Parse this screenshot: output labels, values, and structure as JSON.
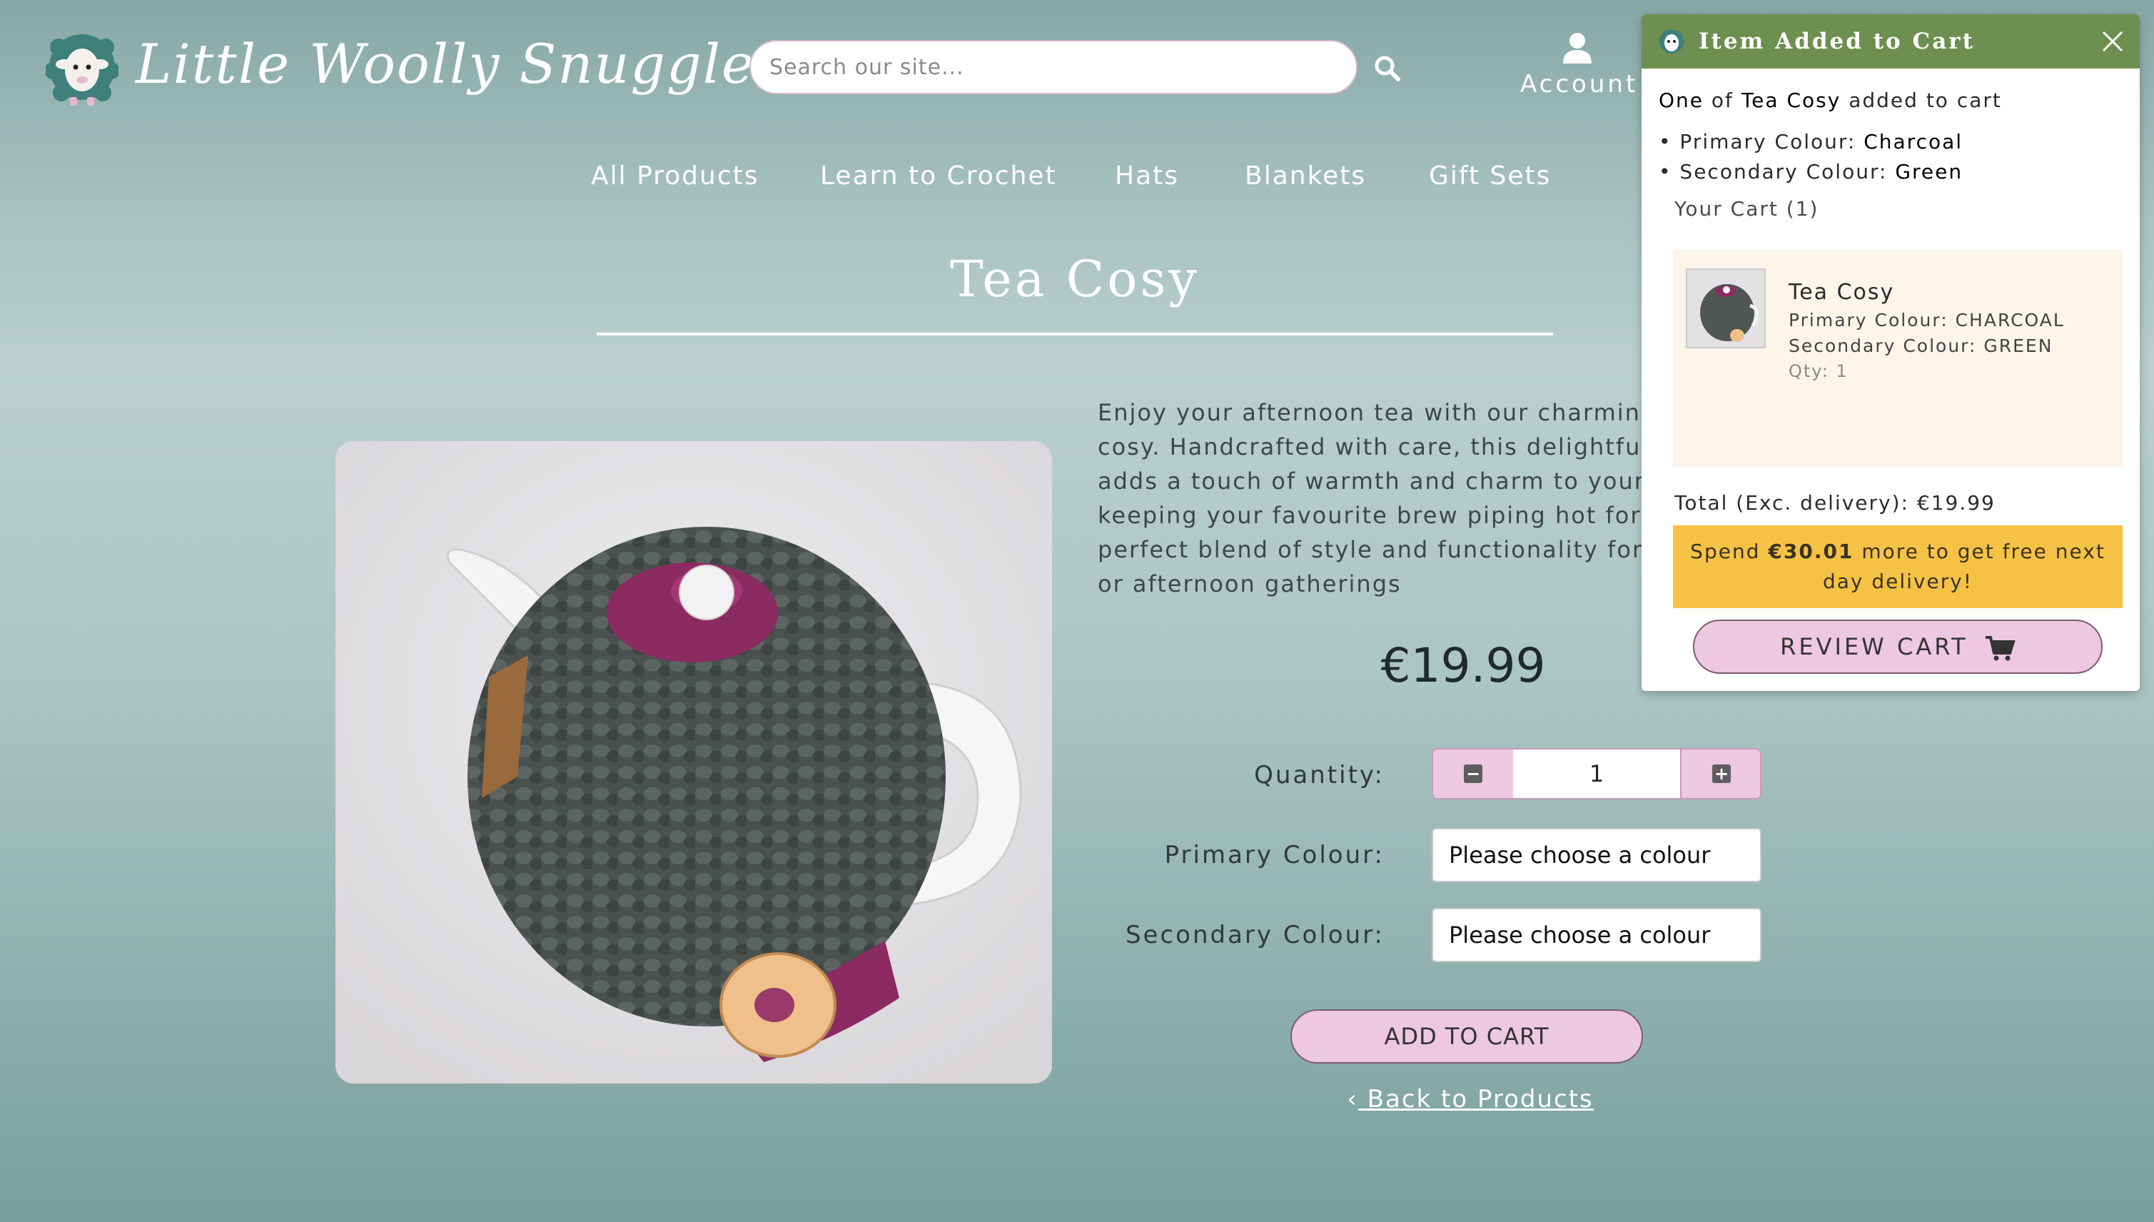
{
  "brand": {
    "name": "Little Woolly Snuggles"
  },
  "search": {
    "placeholder": "Search our site..."
  },
  "header": {
    "account_label": "Account"
  },
  "nav": {
    "items": [
      "All Products",
      "Learn to Crochet",
      "Hats",
      "Blankets",
      "Gift Sets"
    ]
  },
  "product": {
    "title": "Tea Cosy",
    "description": "Enjoy your afternoon tea with our charming crochet tea cosy. Handcrafted with care, this delightful accessory adds a touch of warmth and charm to your teapot, keeping your favourite brew piping hot for longer. A perfect blend of style and functionality for cozy mornings or afternoon gatherings",
    "price": "€19.99",
    "quantity_label": "Quantity:",
    "quantity_value": "1",
    "primary_colour_label": "Primary Colour:",
    "primary_colour_value": "Please choose a colour",
    "secondary_colour_label": "Secondary Colour:",
    "secondary_colour_value": "Please choose a colour",
    "add_to_cart_label": "ADD TO CART",
    "back_link_label": "Back to Products"
  },
  "popup": {
    "title": "Item Added to Cart",
    "added_prefix": "One",
    "added_mid": "of",
    "added_item": "Tea Cosy",
    "added_suffix": "added to cart",
    "option_1_label": "Primary Colour:",
    "option_1_value": "Charcoal",
    "option_2_label": "Secondary Colour:",
    "option_2_value": "Green",
    "cart_heading": "Your Cart (1)",
    "cart_item": {
      "name": "Tea Cosy",
      "primary": "Primary Colour: CHARCOAL",
      "secondary": "Secondary Colour: GREEN",
      "qty": "Qty: 1"
    },
    "total": "Total (Exc. delivery): €19.99",
    "free_delivery_prefix": "Spend",
    "free_delivery_amount": "€30.01",
    "free_delivery_suffix": "more to get free next day delivery!",
    "review_button_label": "REVIEW CART"
  },
  "colors": {
    "popup_header": "#6d8f4f",
    "button_pink": "#eec8e0",
    "banner_yellow": "#f6c245",
    "background_teal": "#a9c3c0"
  },
  "icons": [
    "sheep-logo-icon",
    "search-icon",
    "user-icon",
    "minus-icon",
    "plus-icon",
    "chevron-left-icon",
    "close-icon",
    "cart-icon"
  ]
}
